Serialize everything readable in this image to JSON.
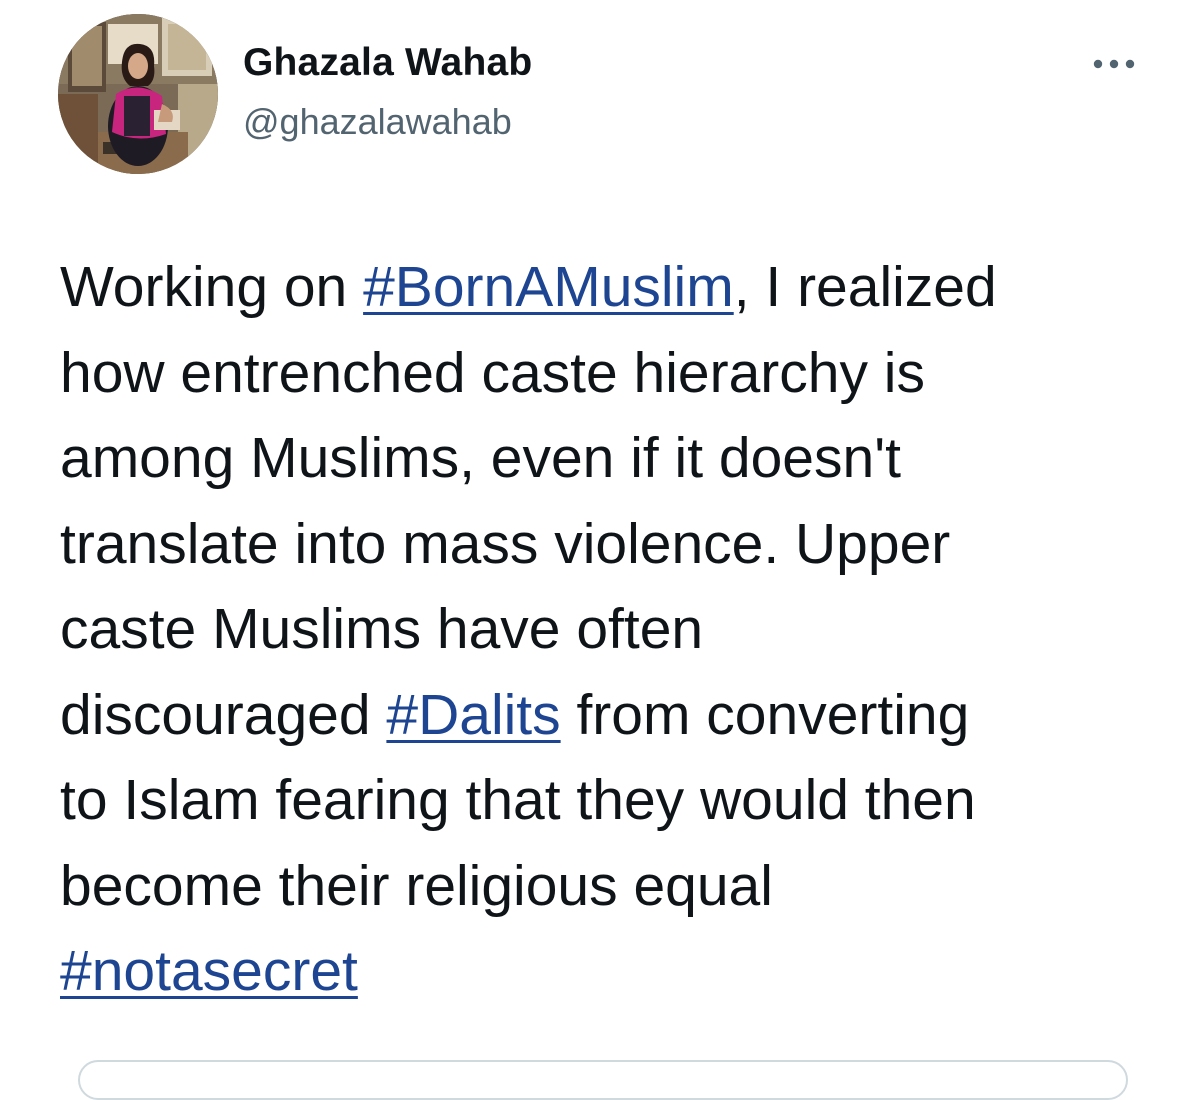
{
  "tweet": {
    "author": {
      "display_name": "Ghazala Wahab",
      "handle": "@ghazalawahab",
      "avatar": "profile-photo"
    },
    "more_icon": "more-horizontal-icon",
    "body": {
      "line1_before": "Working on ",
      "hashtag_1": "#BornAMuslim",
      "line1_after": ", I realized",
      "line2": "how entrenched caste hierarchy is",
      "line3": "among Muslims, even if it doesn't",
      "line4": "translate into mass violence. Upper",
      "line5": "caste Muslims have often",
      "line6_before": "discouraged ",
      "hashtag_2": "#Dalits",
      "line6_after": " from converting",
      "line7": "to Islam fearing that they would then",
      "line8": "become their religious equal",
      "hashtag_3": "#notasecret"
    },
    "colors": {
      "text": "#0f1419",
      "secondary_text": "#536471",
      "hashtag": "#1d4591",
      "border": "#cfd9de"
    }
  }
}
